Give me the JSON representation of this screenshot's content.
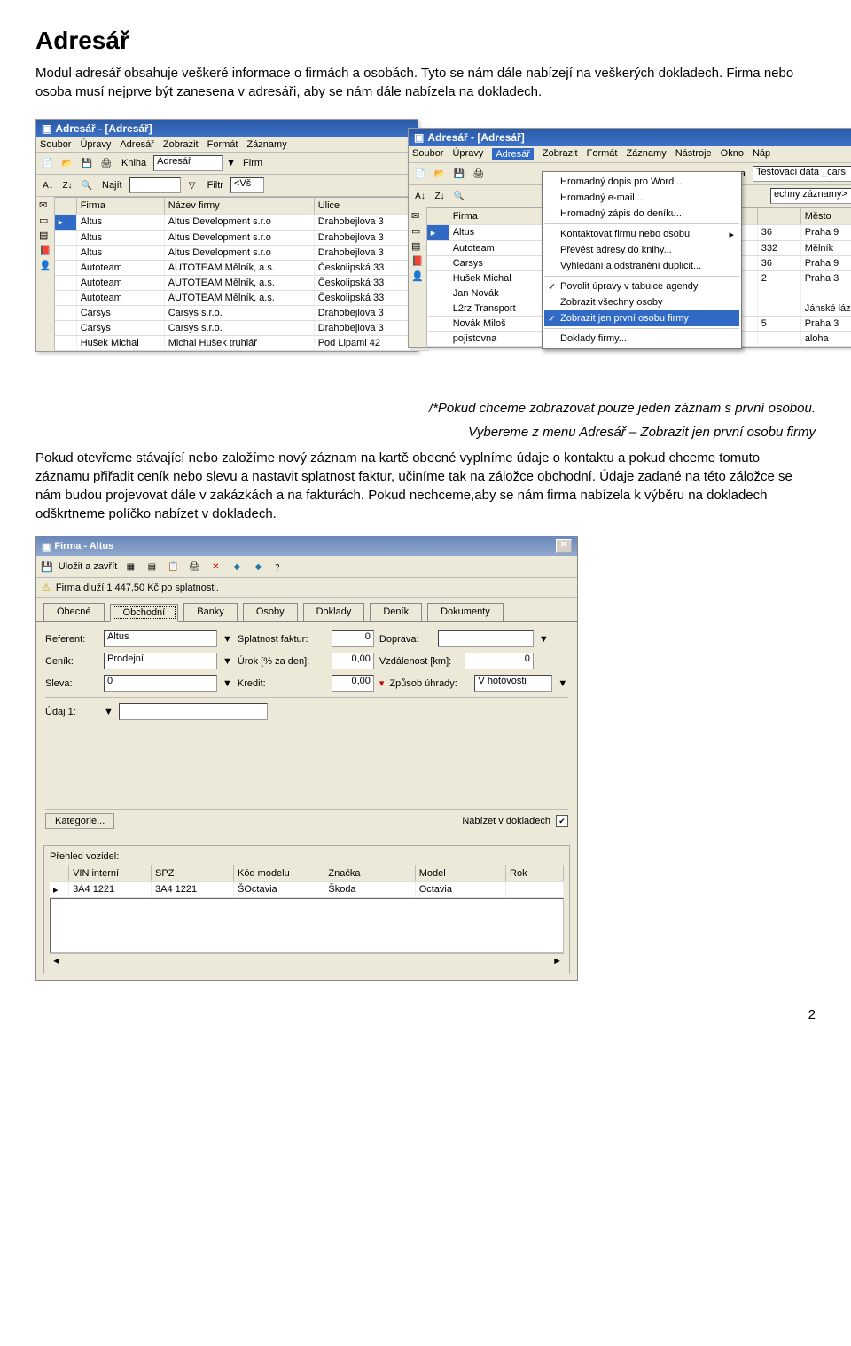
{
  "heading": "Adresář",
  "intro_paragraph": "Modul adresář obsahuje veškeré informace o firmách a osobách. Tyto se nám dále nabízejí na veškerých dokladech. Firma nebo osoba musí nejprve být zanesena v adresáři, aby se nám dále nabízela na dokladech.",
  "note_line1": "/*Pokud chceme zobrazovat pouze jeden záznam s první osobou.",
  "note_line2": "Vybereme z menu Adresář – Zobrazit jen první osobu firmy",
  "body_paragraph": "Pokud otevřeme stávající nebo založíme nový záznam na kartě obecné vyplníme údaje o kontaktu a pokud chceme tomuto záznamu přiřadit ceník nebo slevu a nastavit splatnost faktur, učiníme tak na záložce obchodní. Údaje zadané na této záložce se nám budou projevovat dále v zakázkách a na fakturách. Pokud nechceme,aby se nám firma nabízela k výběru na dokladech odškrtneme políčko nabízet v dokladech.",
  "win_a": {
    "title": "Adresář - [Adresář]",
    "menu": [
      "Soubor",
      "Úpravy",
      "Adresář",
      "Zobrazit",
      "Formát",
      "Záznamy"
    ],
    "toolbar_kniha_lbl": "Kniha",
    "toolbar_kniha_val": "Adresář",
    "toolbar_firma_lbl": "Firm",
    "toolbar2_najit": "Najít",
    "toolbar2_filtr_lbl": "Filtr",
    "toolbar2_filtr_val": "<Vš",
    "columns": [
      "Firma",
      "Název firmy",
      "Ulice"
    ],
    "rows": [
      {
        "firma": "Altus",
        "nazev": "Altus Development s.r.o",
        "ulice": "Drahobejlova 3"
      },
      {
        "firma": "Altus",
        "nazev": "Altus Development s.r.o",
        "ulice": "Drahobejlova 3"
      },
      {
        "firma": "Altus",
        "nazev": "Altus Development s.r.o",
        "ulice": "Drahobejlova 3"
      },
      {
        "firma": "Autoteam",
        "nazev": "AUTOTEAM Mělník, a.s.",
        "ulice": "Českolipská 33"
      },
      {
        "firma": "Autoteam",
        "nazev": "AUTOTEAM Mělník, a.s.",
        "ulice": "Českolipská 33"
      },
      {
        "firma": "Autoteam",
        "nazev": "AUTOTEAM Mělník, a.s.",
        "ulice": "Českolipská 33"
      },
      {
        "firma": "Carsys",
        "nazev": "Carsys s.r.o.",
        "ulice": "Drahobejlova 3"
      },
      {
        "firma": "Carsys",
        "nazev": "Carsys s.r.o.",
        "ulice": "Drahobejlova 3"
      },
      {
        "firma": "Hušek Michal",
        "nazev": "Michal Hušek truhlář",
        "ulice": "Pod Lipami 42"
      }
    ]
  },
  "win_b": {
    "title": "Adresář - [Adresář]",
    "menu": [
      "Soubor",
      "Úpravy",
      "Adresář",
      "Zobrazit",
      "Formát",
      "Záznamy",
      "Nástroje",
      "Okno",
      "Náp"
    ],
    "toolbar_right_lbl": "a",
    "toolbar_right_val": "Testovací data _cars",
    "toolbar2_right_val": "echny záznamy>",
    "col_firma": "Firma",
    "col_mesto": "Město",
    "rows": [
      {
        "firma": "Altus",
        "num": "36",
        "mesto": "Praha 9"
      },
      {
        "firma": "Autoteam",
        "num": "332",
        "mesto": "Mělník"
      },
      {
        "firma": "Carsys",
        "num": "36",
        "mesto": "Praha 9"
      },
      {
        "firma": "Hušek Michal",
        "num": "2",
        "mesto": "Praha 3"
      },
      {
        "firma": "Jan Novák",
        "num": "",
        "mesto": ""
      },
      {
        "firma": "L2rz Transport",
        "num": "",
        "mesto": "Jánské lázně"
      },
      {
        "firma": "Novák Miloš",
        "num": "5",
        "mesto": "Praha 3"
      },
      {
        "firma": "pojistovna",
        "num": "",
        "mesto": "aloha"
      }
    ],
    "menu_items": [
      {
        "label": "Hromadný dopis pro Word...",
        "type": ""
      },
      {
        "label": "Hromadný e-mail...",
        "type": ""
      },
      {
        "label": "Hromadný zápis do deníku...",
        "type": ""
      },
      {
        "label": "",
        "type": "sep"
      },
      {
        "label": "Kontaktovat firmu nebo osobu",
        "type": "arrow"
      },
      {
        "label": "Převést adresy do knihy...",
        "type": ""
      },
      {
        "label": "Vyhledání a odstranění duplicit...",
        "type": ""
      },
      {
        "label": "",
        "type": "sep"
      },
      {
        "label": "Povolit úpravy v tabulce agendy",
        "type": "checked"
      },
      {
        "label": "Zobrazit všechny osoby",
        "type": ""
      },
      {
        "label": "Zobrazit jen první osobu firmy",
        "type": "checked selected"
      },
      {
        "label": "",
        "type": "sep"
      },
      {
        "label": "Doklady firmy...",
        "type": ""
      }
    ]
  },
  "dialog": {
    "title": "Firma - Altus",
    "toolbar_save": "Uložit a zavřít",
    "warning": "Firma dluží 1 447,50 Kč po splatnosti.",
    "tabs": [
      "Obecné",
      "Obchodní",
      "Banky",
      "Osoby",
      "Doklady",
      "Deník",
      "Dokumenty"
    ],
    "active_tab_index": 1,
    "form": {
      "referent_lbl": "Referent:",
      "referent_val": "Altus",
      "cenik_lbl": "Ceník:",
      "cenik_val": "Prodejní",
      "sleva_lbl": "Sleva:",
      "sleva_val": "0",
      "splatnost_lbl": "Splatnost faktur:",
      "splatnost_val": "0",
      "urok_lbl": "Úrok [% za den]:",
      "urok_val": "0,00",
      "kredit_lbl": "Kredit:",
      "kredit_val": "0,00",
      "doprava_lbl": "Doprava:",
      "vzdalenost_lbl": "Vzdálenost [km]:",
      "vzdalenost_val": "0",
      "zpusob_lbl": "Způsob úhrady:",
      "zpusob_val": "V hotovosti",
      "udaj_lbl": "Údaj 1:"
    },
    "kategorie_btn": "Kategorie...",
    "nabizet_lbl": "Nabízet v dokladech",
    "prehled_lbl": "Přehled vozidel:",
    "veh_cols": [
      "VIN interní",
      "SPZ",
      "Kód modelu",
      "Značka",
      "Model",
      "Rok"
    ],
    "veh_row": [
      "3A4 1221",
      "3A4 1221",
      "ŠOctavia",
      "Škoda",
      "Octavia",
      ""
    ]
  },
  "page_number": "2"
}
